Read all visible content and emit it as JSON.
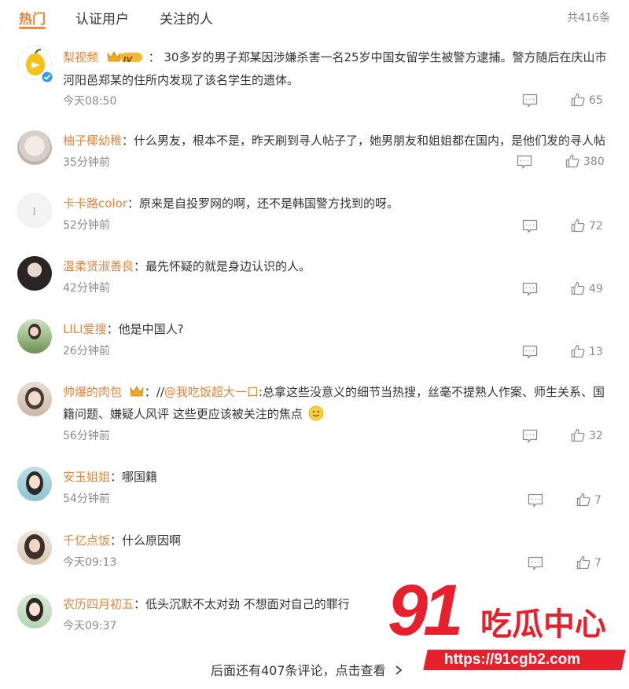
{
  "tabs": [
    {
      "label": "热门"
    },
    {
      "label": "认证用户"
    },
    {
      "label": "关注的人"
    }
  ],
  "total_count": "共416条",
  "comments": [
    {
      "user": "梨视频",
      "badge": "IV",
      "sep": "：",
      "text": "30多岁的男子郑某因涉嫌杀害一名25岁中国女留学生被警方逮捕。警方随后在庆山市河阳邑郑某的住所内发现了该名学生的遗体。",
      "time": "今天08:50",
      "likes": "65"
    },
    {
      "user": "柚子椰幼稚",
      "sep": "：",
      "text": "什么男友，根本不是，昨天刷到寻人帖子了，她男朋友和姐姐都在国内，是他们发的寻人帖",
      "time": "35分钟前",
      "likes": "380"
    },
    {
      "user": "卡卡路color",
      "sep": "：",
      "text": "原来是自投罗网的啊，还不是韩国警方找到的呀。",
      "time": "52分钟前",
      "likes": "72"
    },
    {
      "user": "温柔贤淑善良",
      "sep": "：",
      "text": "最先怀疑的就是身边认识的人。",
      "time": "42分钟前",
      "likes": "49"
    },
    {
      "user": "LILI爱搜",
      "sep": "：",
      "text": "他是中国人?",
      "time": "26分钟前",
      "likes": "13"
    },
    {
      "user": "帅爆的肉包",
      "sep": "：",
      "text_prefix": "//",
      "mention": "@我吃饭超大一口",
      "text": ":总拿这些没意义的细节当热搜，丝毫不提熟人作案、师生关系、国籍问题、嫌疑人风评 这些更应该被关注的焦点",
      "time": "56分钟前",
      "likes": "32"
    },
    {
      "user": "安玉姐姐",
      "sep": "：",
      "text": "哪国籍",
      "time": "54分钟前",
      "likes": "7"
    },
    {
      "user": "千亿点饭",
      "sep": "：",
      "text": "什么原因啊",
      "time": "今天09:13",
      "likes": "7"
    },
    {
      "user": "农历四月初五",
      "sep": "：",
      "text": "低头沉默不太对劲 不想面对自己的罪行",
      "time": "今天09:37",
      "likes": ""
    }
  ],
  "footer": {
    "label": "后面还有407条评论，点击查看"
  },
  "watermark": {
    "big": "91",
    "text": "吃瓜中心",
    "url": "https://91cgb2.com"
  },
  "colors": {
    "accent": "#e8833a",
    "meta": "#8b8b8b",
    "watermark": "#e8202e"
  },
  "icons": [
    "verified-icon",
    "vip-crown-icon",
    "reply-icon",
    "like-icon",
    "chevron-right-icon",
    "smile-emoji-icon"
  ]
}
